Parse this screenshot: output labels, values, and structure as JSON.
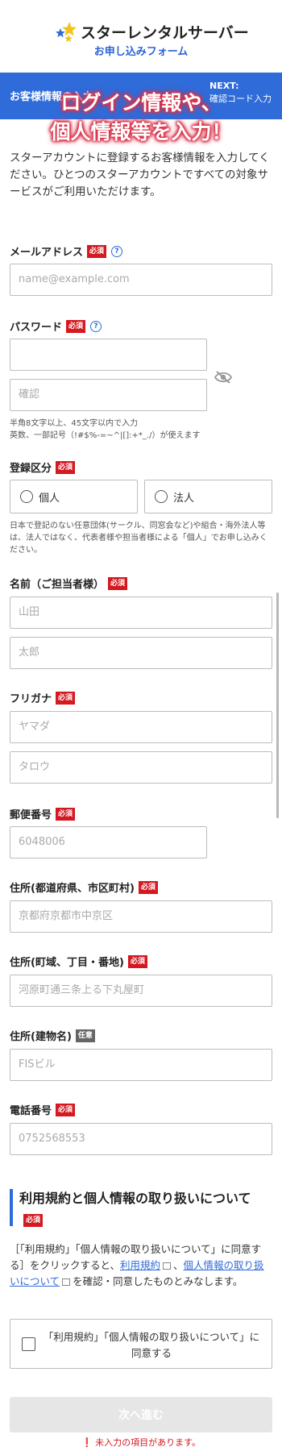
{
  "header": {
    "logo_text": "スターレンタルサーバー",
    "subtitle": "お申し込みフォーム"
  },
  "steps": {
    "current": "お客様情報の入力",
    "next_label": "NEXT:",
    "next_step": "確認コード入力"
  },
  "banner": {
    "line1": "ログイン情報や、",
    "line2": "個人情報等を入力！"
  },
  "intro": "スターアカウントに登録するお客様情報を入力してください。ひとつのスターアカウントですべての対象サービスがご利用いただけます。",
  "required_badge": "必須",
  "optional_badge": "任意",
  "help_mark": "?",
  "email": {
    "label": "メールアドレス",
    "placeholder": "name@example.com"
  },
  "password": {
    "label": "パスワード",
    "placeholder": "",
    "confirm_placeholder": "確認",
    "hint_line1": "半角8文字以上、45文字以内で入力",
    "hint_line2": "英数、一部記号（!#$%-=~^|[]:+*_./）が使えます"
  },
  "registration_type": {
    "label": "登録区分",
    "options": [
      "個人",
      "法人"
    ],
    "note": "日本で登記のない任意団体(サークル、同窓会など)や組合・海外法人等は、法人ではなく、代表者様や担当者様による「個人」でお申し込みください。"
  },
  "name": {
    "label": "名前（ご担当者様）",
    "last_placeholder": "山田",
    "first_placeholder": "太郎"
  },
  "furigana": {
    "label": "フリガナ",
    "last_placeholder": "ヤマダ",
    "first_placeholder": "タロウ"
  },
  "postal": {
    "label": "郵便番号",
    "placeholder": "6048006"
  },
  "address1": {
    "label": "住所(都道府県、市区町村)",
    "placeholder": "京都府京都市中京区"
  },
  "address2": {
    "label": "住所(町域、丁目・番地)",
    "placeholder": "河原町通三条上る下丸屋町"
  },
  "address3": {
    "label": "住所(建物名)",
    "placeholder": "FISビル"
  },
  "phone": {
    "label": "電話番号",
    "placeholder": "0752568553"
  },
  "terms": {
    "title": "利用規約と個人情報の取り扱いについて",
    "text_before": "［「利用規約」「個人情報の取り扱いについて」に同意する］をクリックすると、",
    "link1": "利用規約",
    "separator": "、",
    "link2": "個人情報の取り扱いについて",
    "text_after": "を確認・同意したものとみなします。",
    "agree_label": "「利用規約」「個人情報の取り扱いについて」に同意する"
  },
  "submit": {
    "label": "次へ進む",
    "error": "未入力の項目があります。"
  },
  "colors": {
    "brand_blue": "#2f6bd9",
    "required_red": "#d41920",
    "optional_gray": "#666666",
    "disabled_button": "#e6e6e6"
  }
}
